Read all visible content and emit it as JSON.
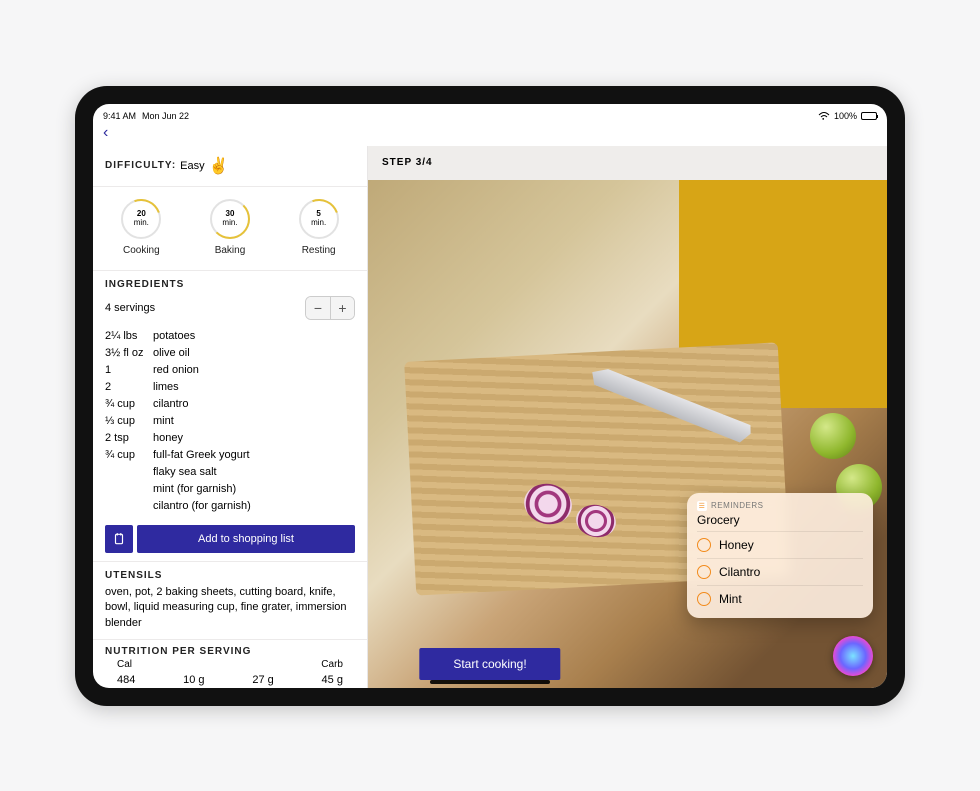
{
  "status": {
    "time": "9:41 AM",
    "date": "Mon Jun 22",
    "battery_pct": "100%"
  },
  "nav": {
    "back_glyph": "‹"
  },
  "difficulty": {
    "label": "DIFFICULTY:",
    "value": "Easy",
    "emoji": "✌️"
  },
  "timers": [
    {
      "value": "20",
      "unit": "min.",
      "label": "Cooking"
    },
    {
      "value": "30",
      "unit": "min.",
      "label": "Baking"
    },
    {
      "value": "5",
      "unit": "min.",
      "label": "Resting"
    }
  ],
  "ingredients": {
    "title": "INGREDIENTS",
    "servings_label": "4 servings",
    "rows": [
      {
        "qty": "2¼ lbs",
        "name": "potatoes"
      },
      {
        "qty": "3½ fl oz",
        "name": "olive oil"
      },
      {
        "qty": "1",
        "name": "red onion"
      },
      {
        "qty": "2",
        "name": "limes"
      },
      {
        "qty": "¾ cup",
        "name": "cilantro"
      },
      {
        "qty": "⅓ cup",
        "name": "mint"
      },
      {
        "qty": "2 tsp",
        "name": "honey"
      },
      {
        "qty": "¾ cup",
        "name": "full-fat Greek yogurt"
      },
      {
        "qty": "",
        "name": "flaky sea salt"
      },
      {
        "qty": "",
        "name": "mint (for garnish)"
      },
      {
        "qty": "",
        "name": "cilantro (for garnish)"
      }
    ],
    "shopping_btn": "Add to shopping list"
  },
  "utensils": {
    "title": "UTENSILS",
    "text": "oven, pot, 2 baking sheets, cutting board, knife, bowl, liquid measuring cup, fine grater, immersion blender"
  },
  "nutrition": {
    "title": "NUTRITION PER SERVING",
    "cols": {
      "cal_label": "Cal",
      "carb_label": "Carb",
      "mid1": "",
      "mid2": ""
    },
    "vals": {
      "cal": "484",
      "v1": "10 g",
      "v2": "27 g",
      "carb": "45 g"
    }
  },
  "start_btn": "Start cooking!",
  "step": {
    "label": "STEP 3/4"
  },
  "reminders": {
    "app_label": "REMINDERS",
    "list_title": "Grocery",
    "items": [
      "Honey",
      "Cilantro",
      "Mint"
    ]
  }
}
